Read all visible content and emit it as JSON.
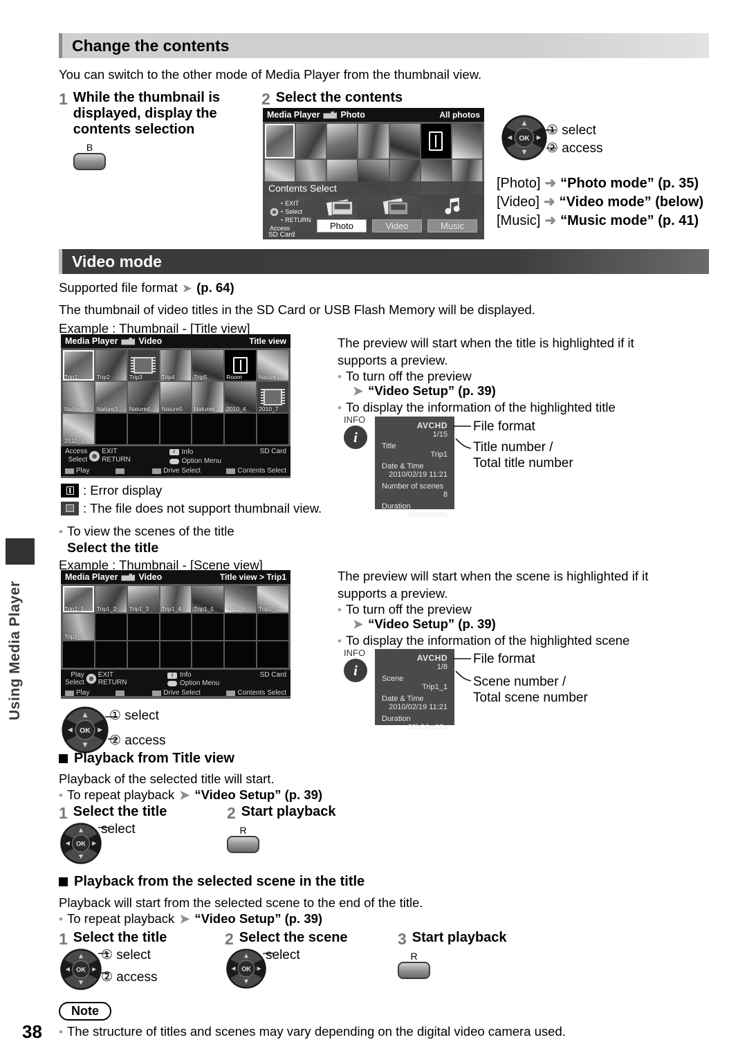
{
  "page": {
    "number": "38",
    "sidebar_label": "Using Media Player"
  },
  "section1": {
    "heading": "Change the contents",
    "intro": "You can switch to the other mode of Media Player from the thumbnail view.",
    "step1": {
      "num": "1",
      "title_line1": "While the thumbnail is",
      "title_line2": "displayed, display the",
      "title_line3": "contents selection",
      "button_label": "B"
    },
    "step2": {
      "num": "2",
      "title": "Select the contents"
    },
    "pad": {
      "label1": "① select",
      "label2": "② access",
      "ok": "OK"
    },
    "modes": [
      {
        "key": "[Photo]",
        "arrow": "➜",
        "value": "“Photo mode” (p. 35)"
      },
      {
        "key": "[Video]",
        "arrow": "➜",
        "value": "“Video mode” (below)"
      },
      {
        "key": "[Music]",
        "arrow": "➜",
        "value": "“Music mode” (p. 41)"
      }
    ]
  },
  "photo_screen": {
    "app": "Media Player",
    "mode": "Photo",
    "view": "All photos",
    "contents_select": {
      "title": "Contents Select",
      "keys": [
        "EXIT",
        "Select",
        "RETURN"
      ],
      "access": "Access",
      "drive": "SD Card",
      "buttons": [
        {
          "label": "Photo",
          "selected": true
        },
        {
          "label": "Video",
          "selected": false
        },
        {
          "label": "Music",
          "selected": false
        }
      ]
    }
  },
  "section2": {
    "heading": "Video mode",
    "supported": "Supported file format",
    "supported_page": "(p. 64)",
    "line1": "The thumbnail of video titles in the SD Card or USB Flash Memory will be displayed.",
    "line2": "Example : Thumbnail - [Title view]",
    "legend": [
      {
        "icon": "error-icon",
        "text": ": Error display"
      },
      {
        "icon": "no-thumbnail-icon",
        "text": ": The file does not support thumbnail view."
      }
    ],
    "right_title": {
      "p1": "The preview will start when the title is highlighted if it",
      "p2": "supports a preview.",
      "b1": "To turn off the preview",
      "b1_link": "“Video Setup” (p. 39)",
      "b2": "To display the information of the highlighted title"
    },
    "right_scene": {
      "p1": "The preview will start when the scene is highlighted if it",
      "p2": "supports a preview.",
      "b1": "To turn off the preview",
      "b1_link": "“Video Setup” (p. 39)",
      "b2": "To display the information of the highlighted scene"
    },
    "scene_intro": {
      "bullet": "To view the scenes of the title",
      "bold": "Select the title",
      "example": "Example : Thumbnail - [Scene view]"
    }
  },
  "title_view_screen": {
    "app": "Media Player",
    "mode": "Video",
    "view": "Title view",
    "thumbs": [
      {
        "cap": "Trip1",
        "kind": "photo",
        "sel": true
      },
      {
        "cap": "Trip2",
        "kind": "photo"
      },
      {
        "cap": "Trip3",
        "kind": "nothumb"
      },
      {
        "cap": "Trip4",
        "kind": "photo"
      },
      {
        "cap": "Trip5",
        "kind": "photo"
      },
      {
        "cap": "Room",
        "kind": "error"
      },
      {
        "cap": "Nature1",
        "kind": "photo"
      },
      {
        "cap": "Nature2",
        "kind": "photo"
      },
      {
        "cap": "Nature3",
        "kind": "photo"
      },
      {
        "cap": "Nature4",
        "kind": "photo"
      },
      {
        "cap": "Nature5",
        "kind": "photo"
      },
      {
        "cap": "Nature6",
        "kind": "photo"
      },
      {
        "cap": "2010_4",
        "kind": "photo"
      },
      {
        "cap": "2010_7",
        "kind": "nothumb"
      },
      {
        "cap": "2010_9",
        "kind": "photo"
      },
      {
        "cap": "",
        "kind": "empty"
      },
      {
        "cap": "",
        "kind": "empty"
      },
      {
        "cap": "",
        "kind": "empty"
      },
      {
        "cap": "",
        "kind": "empty"
      },
      {
        "cap": "",
        "kind": "empty"
      },
      {
        "cap": "",
        "kind": "empty"
      }
    ],
    "footer": {
      "access": "Access",
      "select": "Select",
      "exit": "EXIT",
      "return": "RETURN",
      "info": "Info",
      "option": "Option Menu",
      "drive": "SD Card",
      "keys": [
        "Play",
        "",
        "Drive Select",
        "Contents Select"
      ]
    }
  },
  "scene_view_screen": {
    "app": "Media Player",
    "mode": "Video",
    "view": "Title view  >  Trip1",
    "thumbs": [
      {
        "cap": "Trip1_1",
        "kind": "photo",
        "sel": true
      },
      {
        "cap": "Trip1_2",
        "kind": "photo"
      },
      {
        "cap": "Trip1_3",
        "kind": "photo"
      },
      {
        "cap": "Trip1_4",
        "kind": "photo"
      },
      {
        "cap": "Trip1_5",
        "kind": "photo"
      },
      {
        "cap": "Trip1_6",
        "kind": "photo"
      },
      {
        "cap": "Trip1_7",
        "kind": "photo"
      },
      {
        "cap": "Trip1_8",
        "kind": "photo"
      },
      {
        "cap": "",
        "kind": "empty"
      },
      {
        "cap": "",
        "kind": "empty"
      },
      {
        "cap": "",
        "kind": "empty"
      },
      {
        "cap": "",
        "kind": "empty"
      },
      {
        "cap": "",
        "kind": "empty"
      },
      {
        "cap": "",
        "kind": "empty"
      },
      {
        "cap": "",
        "kind": "empty"
      },
      {
        "cap": "",
        "kind": "empty"
      },
      {
        "cap": "",
        "kind": "empty"
      },
      {
        "cap": "",
        "kind": "empty"
      },
      {
        "cap": "",
        "kind": "empty"
      },
      {
        "cap": "",
        "kind": "empty"
      },
      {
        "cap": "",
        "kind": "empty"
      }
    ],
    "footer": {
      "access": "Play",
      "select": "Select",
      "exit": "EXIT",
      "return": "RETURN",
      "info": "Info",
      "option": "Option Menu",
      "drive": "SD Card",
      "keys": [
        "Play",
        "",
        "Drive Select",
        "Contents Select"
      ]
    }
  },
  "info_title": {
    "label": "INFO",
    "format": "AVCHD",
    "number": "1/15",
    "rows": [
      {
        "k": "Title",
        "v": "Trip1"
      },
      {
        "k": "Date & Time",
        "v": "2010/02/19 11:21"
      },
      {
        "k": "Number of scenes",
        "v": "8"
      },
      {
        "k": "Duration",
        "v": "00h15m39s"
      }
    ],
    "callout1": "File format",
    "callout2_l1": "Title number /",
    "callout2_l2": "Total title number"
  },
  "info_scene": {
    "label": "INFO",
    "format": "AVCHD",
    "number": "1/8",
    "rows": [
      {
        "k": "Scene",
        "v": "Trip1_1"
      },
      {
        "k": "Date & Time",
        "v": "2010/02/19 11:21"
      },
      {
        "k": "Duration",
        "v": "00h04m12s"
      }
    ],
    "callout1": "File format",
    "callout2_l1": "Scene number /",
    "callout2_l2": "Total scene number"
  },
  "scene_pad": {
    "label1": "① select",
    "label2": "② access",
    "ok": "OK"
  },
  "playback_title": {
    "heading": "Playback from Title view",
    "line": "Playback of the selected title will start.",
    "bullet": "To repeat playback",
    "bullet_link": "“Video Setup” (p. 39)",
    "steps": [
      {
        "num": "1",
        "title": "Select the title",
        "pad_label": "select"
      },
      {
        "num": "2",
        "title": "Start playback",
        "button_label": "R"
      }
    ]
  },
  "playback_scene": {
    "heading": "Playback from the selected scene in the title",
    "line": "Playback will start from the selected scene to the end of the title.",
    "bullet": "To repeat playback",
    "bullet_link": "“Video Setup” (p. 39)",
    "steps": [
      {
        "num": "1",
        "title": "Select the title",
        "pad_label1": "① select",
        "pad_label2": "② access"
      },
      {
        "num": "2",
        "title": "Select the scene",
        "pad_label1": "select"
      },
      {
        "num": "3",
        "title": "Start playback",
        "button_label": "R"
      }
    ]
  },
  "note": {
    "label": "Note",
    "text": "The structure of titles and scenes may vary depending on the digital video camera used."
  }
}
